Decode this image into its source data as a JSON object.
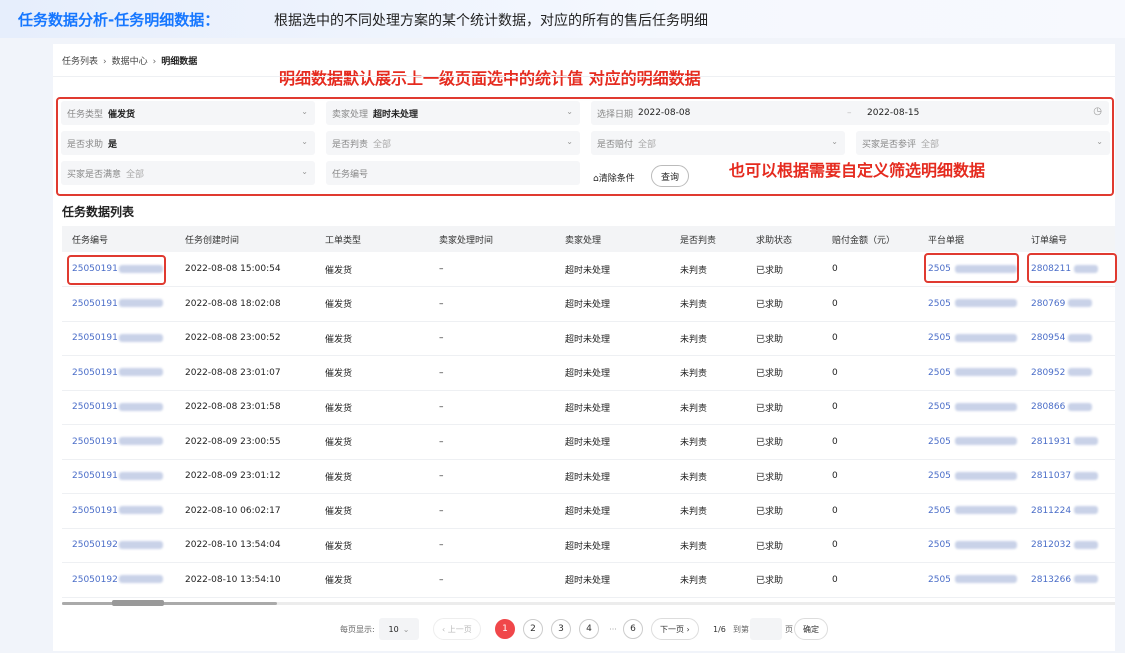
{
  "banner": {
    "title": "任务数据分析-任务明细数据：",
    "desc": "根据选中的不同处理方案的某个统计数据，对应的所有的售后任务明细"
  },
  "breadcrumb": [
    "任务列表",
    "数据中心",
    "明细数据"
  ],
  "breadcrumb_sep": "›",
  "notes": {
    "top": "明细数据默认展示上一级页面选中的统计值 对应的明细数据",
    "right": "也可以根据需要自定义筛选明细数据"
  },
  "filters": {
    "task_type": {
      "label": "任务类型",
      "value": "催发货"
    },
    "seller_handle": {
      "label": "卖家处理",
      "value": "超时未处理"
    },
    "date": {
      "label": "选择日期",
      "start": "2022-08-08",
      "sep": "–",
      "end": "2022-08-15"
    },
    "help": {
      "label": "是否求助",
      "value": "是"
    },
    "judged": {
      "label": "是否判责",
      "value": "全部"
    },
    "compensated": {
      "label": "是否赔付",
      "value": "全部"
    },
    "review": {
      "label": "买家是否参评",
      "value": "全部"
    },
    "satisfied": {
      "label": "买家是否满意",
      "value": "全部"
    },
    "task_no": {
      "placeholder": "任务编号"
    },
    "clear": "清除条件",
    "query": "查询"
  },
  "section_title": "任务数据列表",
  "columns": [
    "任务编号",
    "任务创建时间",
    "工单类型",
    "卖家处理时间",
    "卖家处理",
    "是否判责",
    "求助状态",
    "赔付金额（元）",
    "平台单据",
    "订单编号"
  ],
  "rows": [
    {
      "id": "25050191",
      "time": "2022-08-08 15:00:54",
      "type": "催发货",
      "ptime": "–",
      "handle": "超时未处理",
      "judge": "未判责",
      "help": "已求助",
      "amt": "0",
      "plat": "2505",
      "order": "2808211"
    },
    {
      "id": "25050191",
      "time": "2022-08-08 18:02:08",
      "type": "催发货",
      "ptime": "–",
      "handle": "超时未处理",
      "judge": "未判责",
      "help": "已求助",
      "amt": "0",
      "plat": "2505",
      "order": "280769"
    },
    {
      "id": "25050191",
      "time": "2022-08-08 23:00:52",
      "type": "催发货",
      "ptime": "–",
      "handle": "超时未处理",
      "judge": "未判责",
      "help": "已求助",
      "amt": "0",
      "plat": "2505",
      "order": "280954"
    },
    {
      "id": "25050191",
      "time": "2022-08-08 23:01:07",
      "type": "催发货",
      "ptime": "–",
      "handle": "超时未处理",
      "judge": "未判责",
      "help": "已求助",
      "amt": "0",
      "plat": "2505",
      "order": "280952"
    },
    {
      "id": "25050191",
      "time": "2022-08-08 23:01:58",
      "type": "催发货",
      "ptime": "–",
      "handle": "超时未处理",
      "judge": "未判责",
      "help": "已求助",
      "amt": "0",
      "plat": "2505",
      "order": "280866"
    },
    {
      "id": "25050191",
      "time": "2022-08-09 23:00:55",
      "type": "催发货",
      "ptime": "–",
      "handle": "超时未处理",
      "judge": "未判责",
      "help": "已求助",
      "amt": "0",
      "plat": "2505",
      "order": "2811931"
    },
    {
      "id": "25050191",
      "time": "2022-08-09 23:01:12",
      "type": "催发货",
      "ptime": "–",
      "handle": "超时未处理",
      "judge": "未判责",
      "help": "已求助",
      "amt": "0",
      "plat": "2505",
      "order": "2811037"
    },
    {
      "id": "25050191",
      "time": "2022-08-10 06:02:17",
      "type": "催发货",
      "ptime": "–",
      "handle": "超时未处理",
      "judge": "未判责",
      "help": "已求助",
      "amt": "0",
      "plat": "2505",
      "order": "2811224"
    },
    {
      "id": "25050192",
      "time": "2022-08-10 13:54:04",
      "type": "催发货",
      "ptime": "–",
      "handle": "超时未处理",
      "judge": "未判责",
      "help": "已求助",
      "amt": "0",
      "plat": "2505",
      "order": "2812032"
    },
    {
      "id": "25050192",
      "time": "2022-08-10 13:54:10",
      "type": "催发货",
      "ptime": "–",
      "handle": "超时未处理",
      "judge": "未判责",
      "help": "已求助",
      "amt": "0",
      "plat": "2505",
      "order": "2813266"
    }
  ],
  "pager": {
    "page_size_label": "每页显示:",
    "page_size": "10",
    "prev": "‹ 上一页",
    "pages": [
      "1",
      "2",
      "3",
      "4"
    ],
    "ellipsis": "···",
    "last_page": "6",
    "next": "下一页 ›",
    "total": "1/6",
    "goto_label": "到第",
    "page_unit": "页",
    "confirm": "确定",
    "current": 1
  },
  "colors": {
    "accent": "#1677ff",
    "annotation": "#e52b1f",
    "link": "#4a6dc8",
    "current_page": "#f0474a"
  }
}
